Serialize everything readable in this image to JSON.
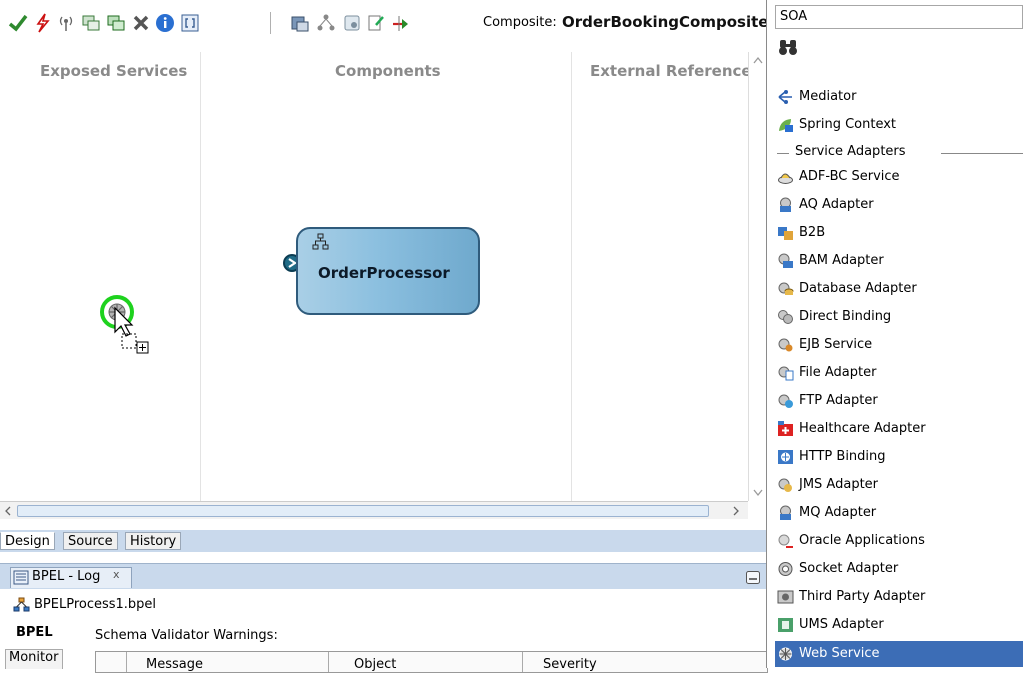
{
  "toolbar": {
    "composite_label": "Composite:",
    "composite_name": "OrderBookingComposite"
  },
  "canvas": {
    "lanes": [
      "Exposed Services",
      "Components",
      "External References"
    ],
    "component": {
      "name": "OrderProcessor"
    }
  },
  "design_tabs": [
    "Design",
    "Source",
    "History"
  ],
  "log_panel": {
    "tab_label": "BPEL - Log",
    "close_glyph": "x",
    "process_file": "BPELProcess1.bpel",
    "side_tabs": [
      "BPEL",
      "Monitor"
    ],
    "warnings_label": "Schema Validator Warnings:",
    "columns": [
      "Message",
      "Object",
      "Severity"
    ]
  },
  "palette": {
    "search_value": "SOA",
    "items_top": [
      "Mediator",
      "Spring Context"
    ],
    "section_label": "Service Adapters",
    "adapters": [
      "ADF-BC Service",
      "AQ Adapter",
      "B2B",
      "BAM Adapter",
      "Database Adapter",
      "Direct Binding",
      "EJB Service",
      "File Adapter",
      "FTP Adapter",
      "Healthcare Adapter",
      "HTTP Binding",
      "JMS Adapter",
      "MQ Adapter",
      "Oracle Applications",
      "Socket Adapter",
      "Third Party Adapter",
      "UMS Adapter",
      "Web Service"
    ],
    "selected_item": "Web Service"
  },
  "colors": {
    "selection": "#3c6db6",
    "component_fill": "#8bbfdf",
    "tab_strip": "#c9d9ec"
  }
}
